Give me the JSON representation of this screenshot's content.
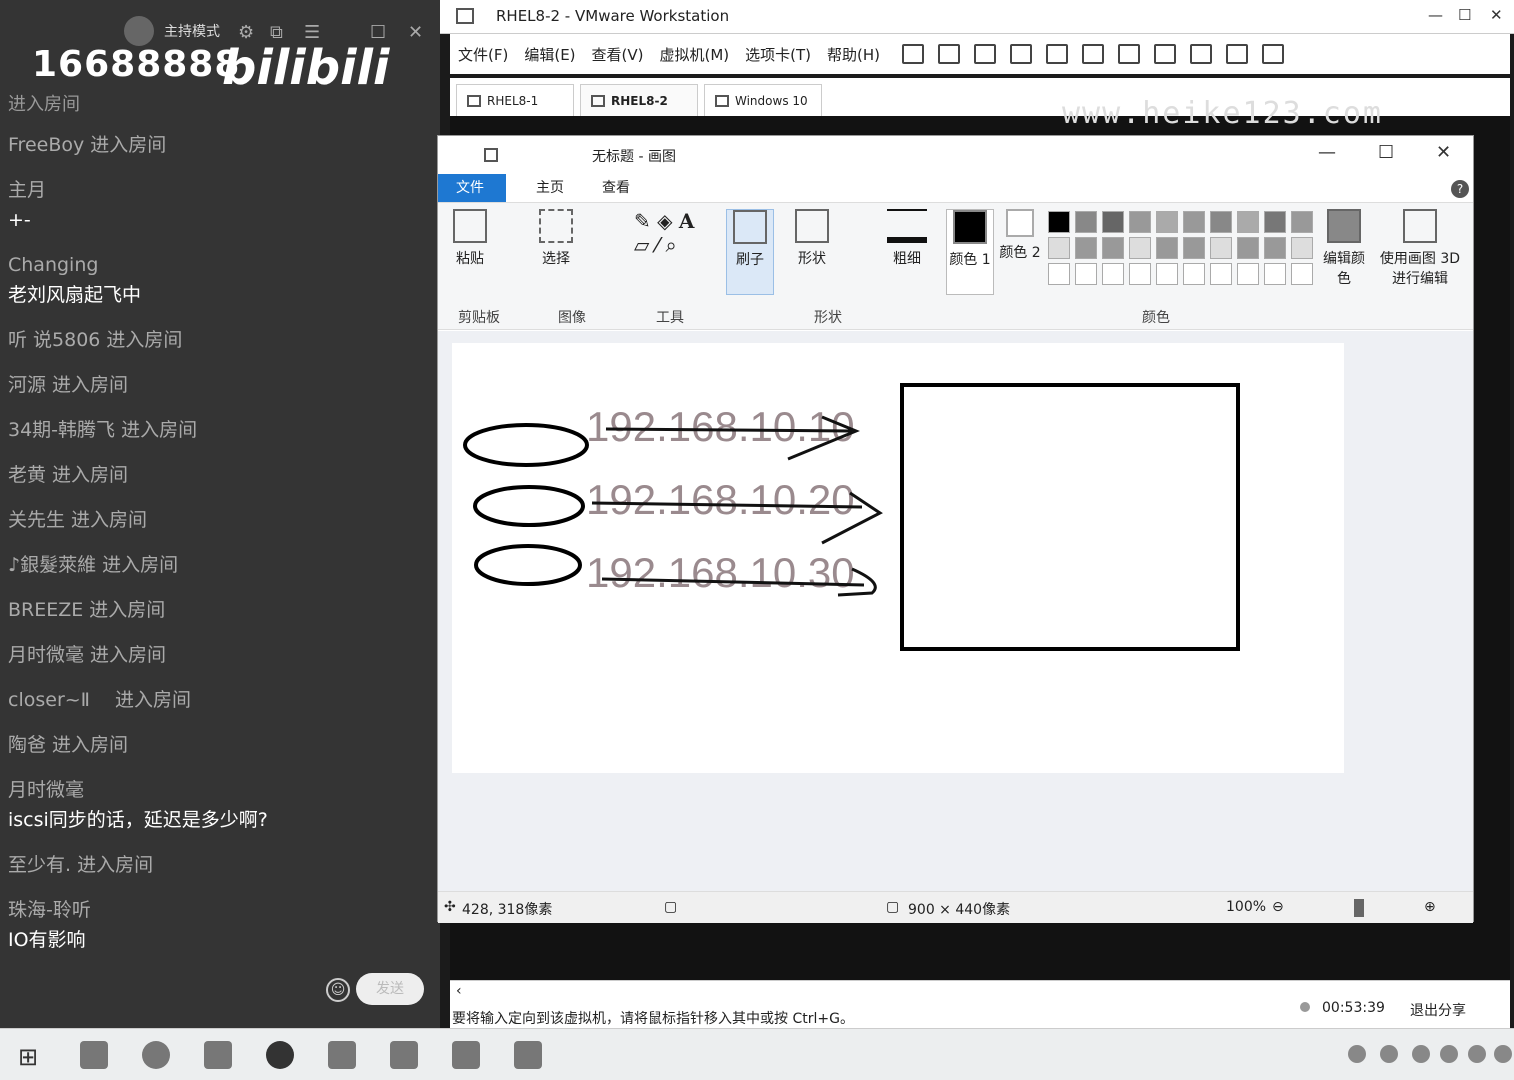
{
  "chat": {
    "host_mode": "主持模式",
    "room_id": "16688888",
    "logo": "bilibili",
    "cut_line": "进入房间",
    "messages": [
      {
        "name": "FreeBoy 进入房间",
        "text": ""
      },
      {
        "name": "主月",
        "text": "+-"
      },
      {
        "name": "Changing",
        "text": "老刘风扇起飞中"
      },
      {
        "name": "听 说5806 进入房间",
        "text": ""
      },
      {
        "name": "河源 进入房间",
        "text": ""
      },
      {
        "name": "34期-韩腾飞 进入房间",
        "text": ""
      },
      {
        "name": "老黄 进入房间",
        "text": ""
      },
      {
        "name": "关先生 进入房间",
        "text": ""
      },
      {
        "name": "♪銀髮萊維 进入房间",
        "text": ""
      },
      {
        "name": "BREEZE 进入房间",
        "text": ""
      },
      {
        "name": "月时微毫 进入房间",
        "text": ""
      },
      {
        "name": "closer~Ⅱ　 进入房间",
        "text": ""
      },
      {
        "name": "陶爸 进入房间",
        "text": ""
      },
      {
        "name": "月时微毫",
        "text": "iscsi同步的话，延迟是多少啊?"
      },
      {
        "name": "至少有. 进入房间",
        "text": ""
      },
      {
        "name": "珠海-聆听",
        "text": "IO有影响"
      }
    ],
    "send_label": "发送"
  },
  "vmware": {
    "title": "RHEL8-2 - VMware Workstation",
    "menus": [
      "文件(F)",
      "编辑(E)",
      "查看(V)",
      "虚拟机(M)",
      "选项卡(T)",
      "帮助(H)"
    ],
    "tabs": [
      "RHEL8-1",
      "RHEL8-2",
      "Windows 10"
    ],
    "active_tab": "RHEL8-2",
    "watermark": "www.heike123.com",
    "status_tip": "要将输入定向到该虚拟机，请将鼠标指针移入其中或按 Ctrl+G。",
    "timer": "00:53:39",
    "exit_share": "退出分享"
  },
  "paint": {
    "title": "无标题 - 画图",
    "ribbon_tabs": [
      "文件",
      "主页",
      "查看"
    ],
    "tools": {
      "paste": "粘贴",
      "select": "选择",
      "brush": "刷子",
      "shapes": "形状",
      "size": "粗细",
      "color1": "颜色 1",
      "color2": "颜色 2",
      "edit_colors": "编辑颜色",
      "paint3d": "使用画图 3D 进行编辑"
    },
    "groups": [
      "剪贴板",
      "图像",
      "工具",
      "形状",
      "颜色"
    ],
    "canvas_text": [
      "192.168.10.10",
      "192.168.10.20",
      "192.168.10.30"
    ],
    "cursor_pos": "428, 318像素",
    "canvas_size": "900 × 440像素",
    "zoom": "100%"
  }
}
